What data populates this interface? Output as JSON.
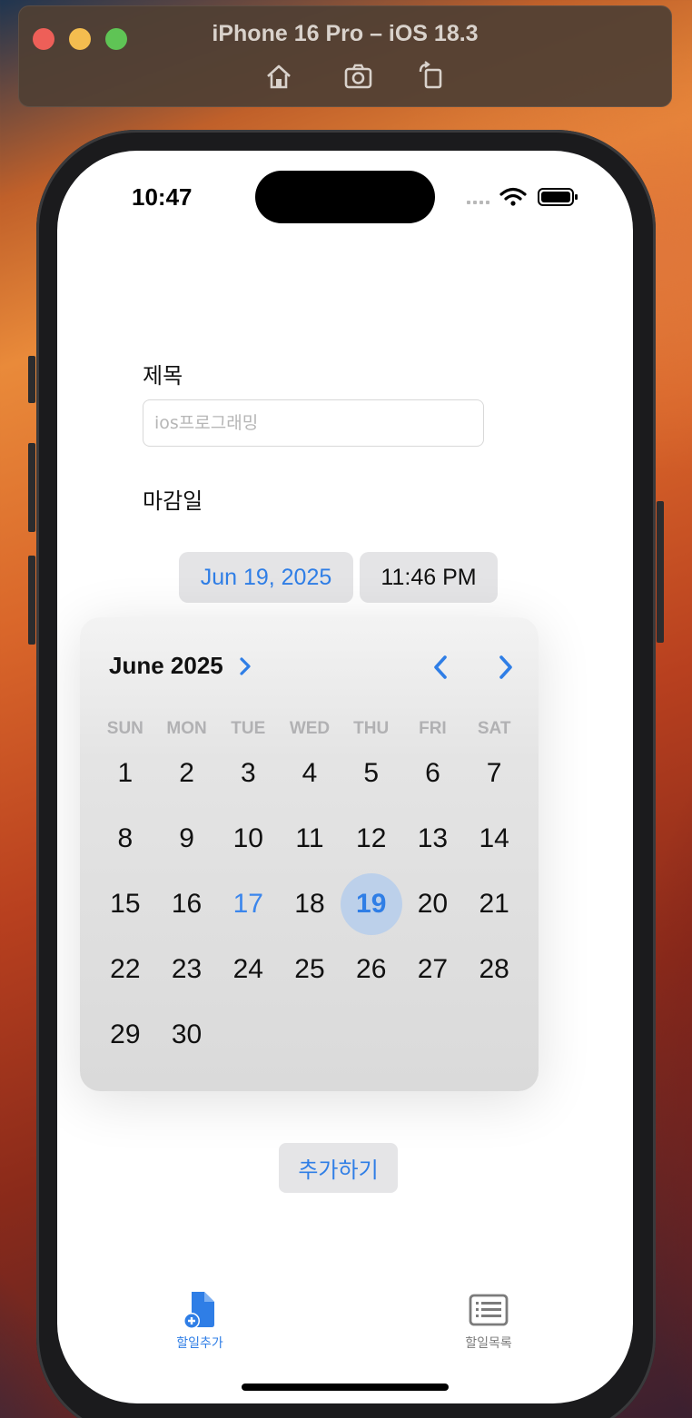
{
  "window": {
    "title": "iPhone 16 Pro – iOS 18.3",
    "toolbar_icons": [
      "home-icon",
      "screenshot-icon",
      "rotate-icon"
    ]
  },
  "status_bar": {
    "time": "10:47",
    "icons": [
      "signal-icon",
      "wifi-icon",
      "battery-icon"
    ]
  },
  "form": {
    "title_label": "제목",
    "title_placeholder": "ios프로그래밍",
    "title_value": "",
    "deadline_label": "마감일",
    "date_value": "Jun 19, 2025",
    "time_value": "11:46 PM",
    "add_button": "추가하기"
  },
  "calendar": {
    "month_label": "June 2025",
    "weekdays": [
      "SUN",
      "MON",
      "TUE",
      "WED",
      "THU",
      "FRI",
      "SAT"
    ],
    "days": [
      "1",
      "2",
      "3",
      "4",
      "5",
      "6",
      "7",
      "8",
      "9",
      "10",
      "11",
      "12",
      "13",
      "14",
      "15",
      "16",
      "17",
      "18",
      "19",
      "20",
      "21",
      "22",
      "23",
      "24",
      "25",
      "26",
      "27",
      "28",
      "29",
      "30"
    ],
    "first_weekday_index": 0,
    "today": "17",
    "selected": "19"
  },
  "tab_bar": {
    "tabs": [
      {
        "label": "할일추가",
        "icon": "add-document-icon",
        "active": true
      },
      {
        "label": "할일목록",
        "icon": "list-icon",
        "active": false
      }
    ]
  },
  "colors": {
    "accent": "#2f7ee6",
    "selected_circle": "#bcd0ea",
    "inactive_tab": "#7b7b7b"
  }
}
